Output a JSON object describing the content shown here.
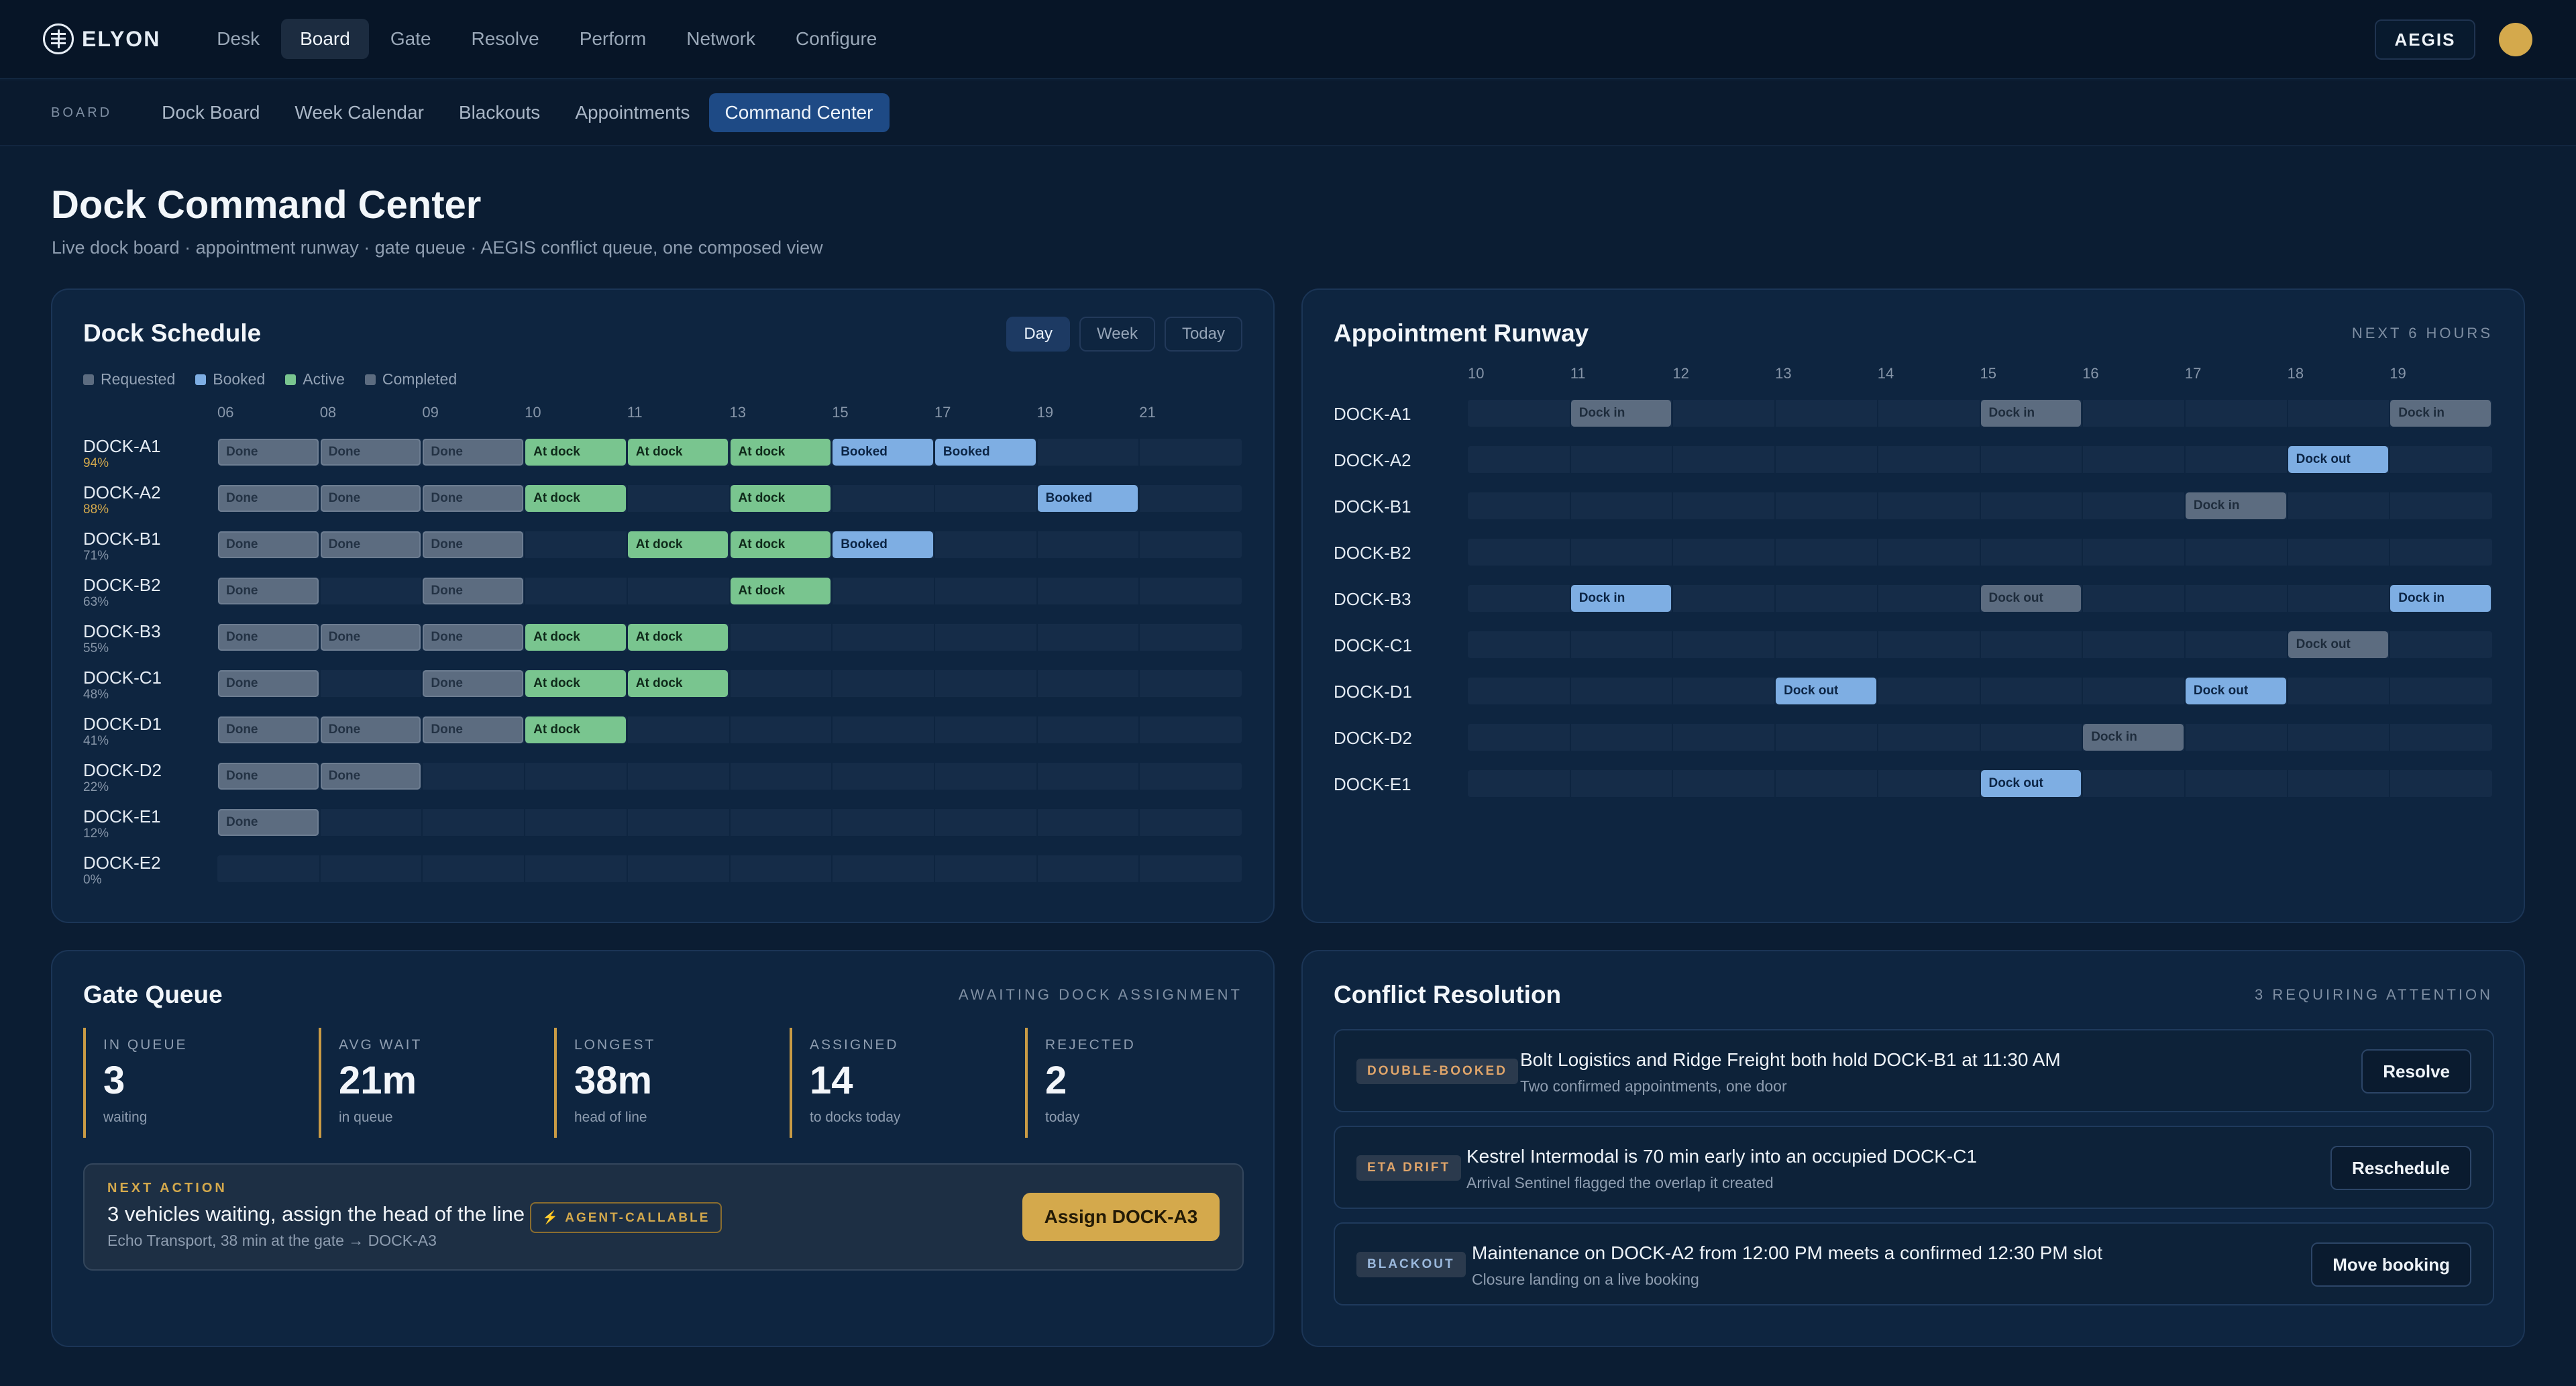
{
  "brand": {
    "name": "ELYON"
  },
  "topnav": {
    "items": [
      {
        "label": "Desk",
        "active": false
      },
      {
        "label": "Board",
        "active": true
      },
      {
        "label": "Gate",
        "active": false
      },
      {
        "label": "Resolve",
        "active": false
      },
      {
        "label": "Perform",
        "active": false
      },
      {
        "label": "Network",
        "active": false
      },
      {
        "label": "Configure",
        "active": false
      }
    ],
    "aegis_label": "AEGIS"
  },
  "subnav": {
    "section_label": "BOARD",
    "items": [
      {
        "label": "Dock Board",
        "active": false
      },
      {
        "label": "Week Calendar",
        "active": false
      },
      {
        "label": "Blackouts",
        "active": false
      },
      {
        "label": "Appointments",
        "active": false
      },
      {
        "label": "Command Center",
        "active": true
      }
    ]
  },
  "page": {
    "title": "Dock Command Center",
    "subtitle": "Live dock board · appointment runway · gate queue · AEGIS conflict queue, one composed view"
  },
  "schedule": {
    "title": "Dock Schedule",
    "views": [
      "Day",
      "Week",
      "Today"
    ],
    "active_view": "Day",
    "legend": [
      {
        "label": "Requested",
        "color": "#5c6c80"
      },
      {
        "label": "Booked",
        "color": "#7eaee3"
      },
      {
        "label": "Active",
        "color": "#79c58f"
      },
      {
        "label": "Completed",
        "color": "#5c6c80"
      }
    ],
    "hours": [
      "06",
      "08",
      "09",
      "10",
      "11",
      "13",
      "15",
      "17",
      "19",
      "21"
    ],
    "docks": [
      {
        "name": "DOCK-A1",
        "util": "94%",
        "util_color": "#d4a94c",
        "blocks": [
          {
            "col": 0,
            "type": "done",
            "label": "Done"
          },
          {
            "col": 1,
            "type": "done",
            "label": "Done"
          },
          {
            "col": 2,
            "type": "done",
            "label": "Done"
          },
          {
            "col": 3,
            "type": "atdock",
            "label": "At dock"
          },
          {
            "col": 4,
            "type": "atdock",
            "label": "At dock"
          },
          {
            "col": 5,
            "type": "atdock",
            "label": "At dock"
          },
          {
            "col": 6,
            "type": "booked",
            "label": "Booked"
          },
          {
            "col": 7,
            "type": "booked",
            "label": "Booked"
          }
        ]
      },
      {
        "name": "DOCK-A2",
        "util": "88%",
        "util_color": "#d4a94c",
        "blocks": [
          {
            "col": 0,
            "type": "done",
            "label": "Done"
          },
          {
            "col": 1,
            "type": "done",
            "label": "Done"
          },
          {
            "col": 2,
            "type": "done",
            "label": "Done"
          },
          {
            "col": 3,
            "type": "atdock",
            "label": "At dock"
          },
          {
            "col": 5,
            "type": "atdock",
            "label": "At dock"
          },
          {
            "col": 8,
            "type": "booked",
            "label": "Booked"
          }
        ]
      },
      {
        "name": "DOCK-B1",
        "util": "71%",
        "util_color": "#8796a9",
        "blocks": [
          {
            "col": 0,
            "type": "done",
            "label": "Done"
          },
          {
            "col": 1,
            "type": "done",
            "label": "Done"
          },
          {
            "col": 2,
            "type": "done",
            "label": "Done"
          },
          {
            "col": 4,
            "type": "atdock",
            "label": "At dock"
          },
          {
            "col": 5,
            "type": "atdock",
            "label": "At dock"
          },
          {
            "col": 6,
            "type": "booked",
            "label": "Booked"
          }
        ]
      },
      {
        "name": "DOCK-B2",
        "util": "63%",
        "util_color": "#8796a9",
        "blocks": [
          {
            "col": 0,
            "type": "done",
            "label": "Done"
          },
          {
            "col": 2,
            "type": "done",
            "label": "Done"
          },
          {
            "col": 5,
            "type": "atdock",
            "label": "At dock"
          }
        ]
      },
      {
        "name": "DOCK-B3",
        "util": "55%",
        "util_color": "#8796a9",
        "blocks": [
          {
            "col": 0,
            "type": "done",
            "label": "Done"
          },
          {
            "col": 1,
            "type": "done",
            "label": "Done"
          },
          {
            "col": 2,
            "type": "done",
            "label": "Done"
          },
          {
            "col": 3,
            "type": "atdock",
            "label": "At dock"
          },
          {
            "col": 4,
            "type": "atdock",
            "label": "At dock"
          }
        ]
      },
      {
        "name": "DOCK-C1",
        "util": "48%",
        "util_color": "#8796a9",
        "blocks": [
          {
            "col": 0,
            "type": "done",
            "label": "Done"
          },
          {
            "col": 2,
            "type": "done",
            "label": "Done"
          },
          {
            "col": 3,
            "type": "atdock",
            "label": "At dock"
          },
          {
            "col": 4,
            "type": "atdock",
            "label": "At dock"
          }
        ]
      },
      {
        "name": "DOCK-D1",
        "util": "41%",
        "util_color": "#8796a9",
        "blocks": [
          {
            "col": 0,
            "type": "done",
            "label": "Done"
          },
          {
            "col": 1,
            "type": "done",
            "label": "Done"
          },
          {
            "col": 2,
            "type": "done",
            "label": "Done"
          },
          {
            "col": 3,
            "type": "atdock",
            "label": "At dock"
          }
        ]
      },
      {
        "name": "DOCK-D2",
        "util": "22%",
        "util_color": "#8796a9",
        "blocks": [
          {
            "col": 0,
            "type": "done",
            "label": "Done"
          },
          {
            "col": 1,
            "type": "done",
            "label": "Done"
          }
        ]
      },
      {
        "name": "DOCK-E1",
        "util": "12%",
        "util_color": "#8796a9",
        "blocks": [
          {
            "col": 0,
            "type": "done",
            "label": "Done"
          }
        ]
      },
      {
        "name": "DOCK-E2",
        "util": "0%",
        "util_color": "#8796a9",
        "blocks": []
      }
    ]
  },
  "runway": {
    "title": "Appointment Runway",
    "tag": "NEXT 6 HOURS",
    "hours": [
      "10",
      "11",
      "12",
      "13",
      "14",
      "15",
      "16",
      "17",
      "18",
      "19"
    ],
    "docks": [
      {
        "name": "DOCK-A1",
        "blocks": [
          {
            "col": 1,
            "type": "in",
            "label": "Dock in"
          },
          {
            "col": 5,
            "type": "in",
            "label": "Dock in"
          },
          {
            "col": 9,
            "type": "in",
            "label": "Dock in"
          }
        ]
      },
      {
        "name": "DOCK-A2",
        "blocks": [
          {
            "col": 8,
            "type": "out",
            "label": "Dock out"
          }
        ]
      },
      {
        "name": "DOCK-B1",
        "blocks": [
          {
            "col": 7,
            "type": "in",
            "label": "Dock in"
          }
        ]
      },
      {
        "name": "DOCK-B2",
        "blocks": []
      },
      {
        "name": "DOCK-B3",
        "blocks": [
          {
            "col": 1,
            "type": "out",
            "label": "Dock in"
          },
          {
            "col": 5,
            "type": "out-grey",
            "label": "Dock out"
          },
          {
            "col": 9,
            "type": "out",
            "label": "Dock in"
          }
        ]
      },
      {
        "name": "DOCK-C1",
        "blocks": [
          {
            "col": 8,
            "type": "out-grey",
            "label": "Dock out"
          }
        ]
      },
      {
        "name": "DOCK-D1",
        "blocks": [
          {
            "col": 3,
            "type": "out",
            "label": "Dock out"
          },
          {
            "col": 7,
            "type": "out",
            "label": "Dock out"
          }
        ]
      },
      {
        "name": "DOCK-D2",
        "blocks": [
          {
            "col": 6,
            "type": "in",
            "label": "Dock in"
          }
        ]
      },
      {
        "name": "DOCK-E1",
        "blocks": [
          {
            "col": 5,
            "type": "out",
            "label": "Dock out"
          }
        ]
      }
    ]
  },
  "gate": {
    "title": "Gate Queue",
    "tag": "AWAITING DOCK ASSIGNMENT",
    "stats": [
      {
        "label": "IN QUEUE",
        "value": "3",
        "sub": "waiting"
      },
      {
        "label": "AVG WAIT",
        "value": "21m",
        "sub": "in queue"
      },
      {
        "label": "LONGEST",
        "value": "38m",
        "sub": "head of line"
      },
      {
        "label": "ASSIGNED",
        "value": "14",
        "sub": "to docks today"
      },
      {
        "label": "REJECTED",
        "value": "2",
        "sub": "today"
      }
    ],
    "next_action": {
      "label": "NEXT ACTION",
      "main": "3 vehicles waiting, assign the head of the line",
      "sub": "Echo Transport, 38 min at the gate → DOCK-A3",
      "badge": "⚡ AGENT-CALLABLE",
      "button": "Assign DOCK-A3"
    }
  },
  "conflicts": {
    "title": "Conflict Resolution",
    "tag": "3 REQUIRING ATTENTION",
    "items": [
      {
        "badge": "DOUBLE-BOOKED",
        "badge_color": "#e0a56a",
        "title": "Bolt Logistics and Ridge Freight both hold DOCK-B1 at 11:30 AM",
        "sub": "Two confirmed appointments, one door",
        "action": "Resolve"
      },
      {
        "badge": "ETA DRIFT",
        "badge_color": "#e0a56a",
        "title": "Kestrel Intermodal is 70 min early into an occupied DOCK-C1",
        "sub": "Arrival Sentinel flagged the overlap it created",
        "action": "Reschedule"
      },
      {
        "badge": "BLACKOUT",
        "badge_color": "#9ab8dc",
        "title": "Maintenance on DOCK-A2 from 12:00 PM meets a confirmed 12:30 PM slot",
        "sub": "Closure landing on a live booking",
        "action": "Move booking"
      }
    ]
  }
}
